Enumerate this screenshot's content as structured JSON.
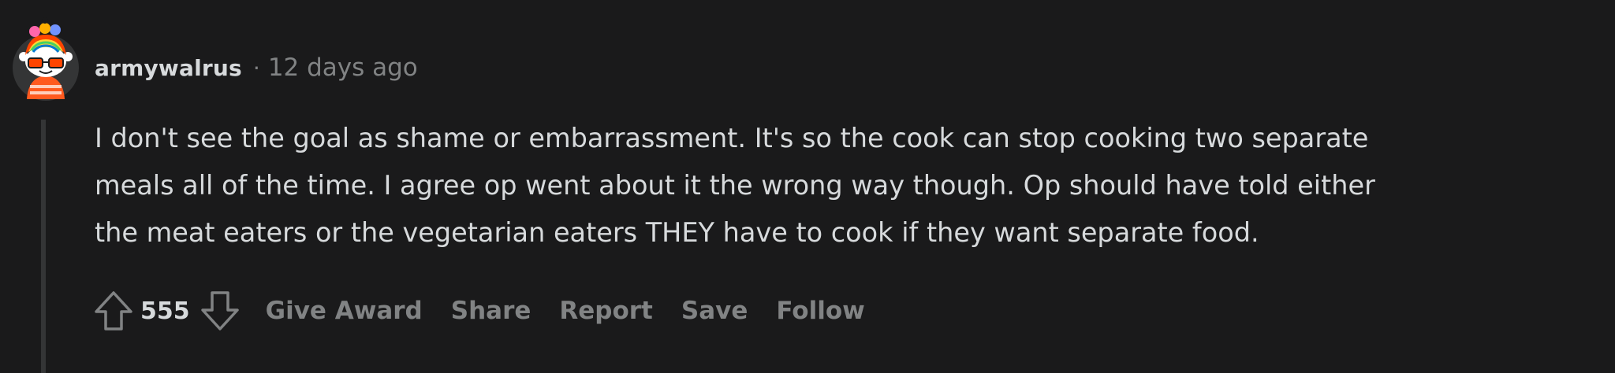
{
  "comment": {
    "author": "armywalrus",
    "separator": "·",
    "timestamp": "12 days ago",
    "body_lines": [
      "I don't see the goal as shame or embarrassment. It's so the cook can stop cooking two separate",
      "meals all of the time. I agree op went about it the wrong way though. Op should have told either",
      "the meat eaters or the vegetarian eaters THEY have to cook if they want separate food."
    ],
    "score": "555",
    "actions": {
      "give_award": "Give Award",
      "share": "Share",
      "report": "Report",
      "save": "Save",
      "follow": "Follow"
    },
    "icons": {
      "upvote": "upvote-arrow-icon",
      "downvote": "downvote-arrow-icon",
      "avatar": "snoo-avatar"
    }
  },
  "colors": {
    "background": "#1a1a1b",
    "text_primary": "#d7dadc",
    "text_muted": "#818384",
    "thread_line": "#343536"
  }
}
